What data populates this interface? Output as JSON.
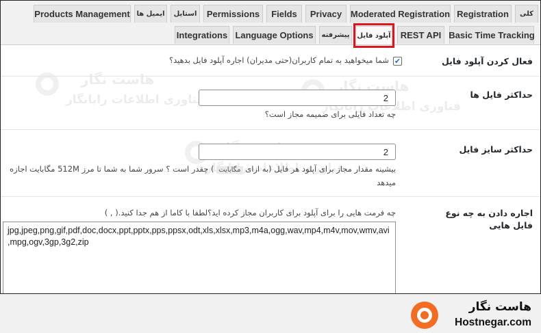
{
  "tabs_row1": [
    {
      "label": "Products Management"
    },
    {
      "label": "ایمیل ها"
    },
    {
      "label": "استایل"
    },
    {
      "label": "Permissions"
    },
    {
      "label": "Fields"
    },
    {
      "label": "Privacy"
    },
    {
      "label": "Moderated Registration"
    },
    {
      "label": "Registration"
    },
    {
      "label": "کلی"
    }
  ],
  "tabs_row2": [
    {
      "label": "Integrations"
    },
    {
      "label": "Language Options"
    },
    {
      "label": "پیشرفته"
    },
    {
      "label": "آپلود فایل",
      "active": true
    },
    {
      "label": "REST API"
    },
    {
      "label": "Basic Time Tracking"
    }
  ],
  "settings": {
    "enable_upload": {
      "label": "فعال کردن آپلود فایل",
      "checkbox_label": "شما میخواهید به تمام کاربران(حتی مدیران) اجاره آپلود فایل بدهید؟",
      "checked": true
    },
    "max_files": {
      "label": "حداکثر فایل ها",
      "value": "2",
      "description": "چه تعداد فایلی برای ضمیمه مجاز است؟"
    },
    "max_size": {
      "label": "حداکثر سایز فایل",
      "value": "2",
      "description_a": "بیشینه مقدار مجاز برای آپلود هر فایل (به ازای",
      "description_code": "مگابایت",
      "description_b": ") چقدر است ؟ سرور شما به شما تا مرز 512M مگابایت اجازه میدهد"
    },
    "allowed_types": {
      "label": "اجاره دادن به چه نوع فایل هایی",
      "description": "چه فرمت هایی را برای آپلود برای کاربران مجاز کرده اید؟لطفا با کاما از هم جدا کنید.( , )",
      "value": "jpg,jpeg,png,gif,pdf,doc,docx,ppt,pptx,pps,ppsx,odt,xls,xlsx,mp3,m4a,ogg,wav,mp4,m4v,mov,wmv,avi,mpg,ogv,3gp,3g2,zip"
    }
  },
  "watermark": {
    "title": "هاست نگار",
    "subtitle": "فناوری اطلاعات رایانگار"
  },
  "brand": {
    "name_fa": "هاست نگار",
    "name_en": "Hostnegar.com",
    "color": "#f36c21"
  },
  "colors": {
    "highlight": "#e0141e",
    "checkbox_check": "#1e6fd9"
  }
}
